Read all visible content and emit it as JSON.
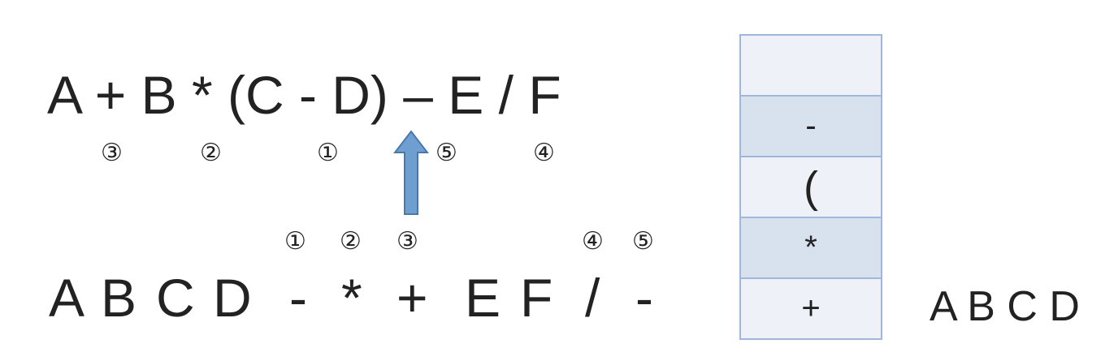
{
  "colors": {
    "stack_border": "#9fb7d8",
    "stack_light": "#eef1f7",
    "stack_dark": "#d8e1ee",
    "arrow_fill": "#6f9fd1",
    "arrow_stroke": "#4a78a8"
  },
  "infix": {
    "expression": "A + B * (C - D) – E / F",
    "markers": [
      "③",
      "②",
      "①",
      "⑤",
      "④"
    ]
  },
  "postfix": {
    "tokens": [
      "A",
      "B",
      "C",
      "D",
      "-",
      "*",
      "+",
      "E",
      "F",
      "/",
      "-"
    ],
    "markers": [
      "①",
      "②",
      "③",
      "④",
      "⑤"
    ]
  },
  "stack": {
    "cells": [
      "",
      "-",
      "(",
      "*",
      "+"
    ]
  },
  "output": "A B C D",
  "arrow": {
    "icon": "up-arrow-icon"
  }
}
